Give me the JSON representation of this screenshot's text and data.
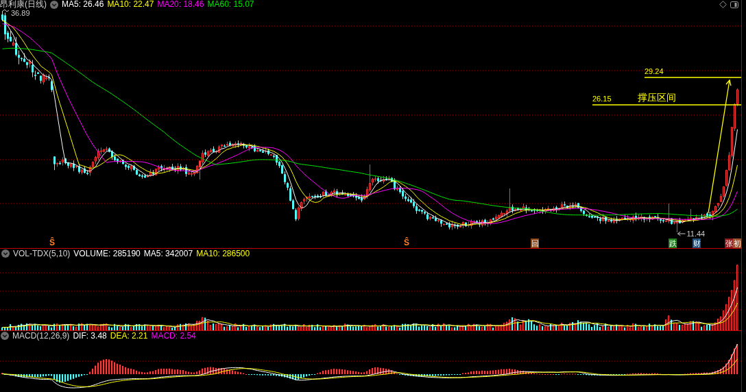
{
  "main_pane": {
    "title": "昂利康(日线)",
    "indicators": [
      {
        "label": "MA5: 26.46",
        "color": "#ffffff"
      },
      {
        "label": "MA10: 22.47",
        "color": "#ffff00"
      },
      {
        "label": "MA20: 18.46",
        "color": "#ff00ff"
      },
      {
        "label": "MA60: 15.07",
        "color": "#00e600"
      }
    ],
    "high_label": "36.89",
    "low_label": "11.44",
    "zone": {
      "upper": "29.24",
      "lower": "26.15",
      "label": "撑压区间"
    },
    "markers": [
      {
        "kind": "glyph",
        "text": "Ŝ",
        "color": "#ff7f27"
      },
      {
        "kind": "glyph",
        "text": "Ŝ",
        "color": "#ff7f27"
      },
      {
        "kind": "tag",
        "text": "回",
        "color": "#8b4513"
      },
      {
        "kind": "tag",
        "text": "跌",
        "color": "#1e7b1e"
      },
      {
        "kind": "tag",
        "text": "财",
        "color": "#1f4e79"
      },
      {
        "kind": "tag",
        "text": "张",
        "color": "#8b1a1a"
      },
      {
        "kind": "tag",
        "text": "初",
        "color": "#a0522d"
      }
    ]
  },
  "volume_pane": {
    "title": "VOL-TDX(5,10)",
    "indicators": [
      {
        "label": "VOLUME: 285190",
        "color": "#ffffff"
      },
      {
        "label": "MA5: 342007",
        "color": "#ffffff"
      },
      {
        "label": "MA10: 286500",
        "color": "#ffff00"
      }
    ]
  },
  "macd_pane": {
    "title": "MACD(12,26,9)",
    "indicators": [
      {
        "label": "DIF: 3.48",
        "color": "#ffffff"
      },
      {
        "label": "DEA: 2.21",
        "color": "#ffff00"
      },
      {
        "label": "MACD: 2.54",
        "color": "#ff00ff"
      }
    ]
  }
}
